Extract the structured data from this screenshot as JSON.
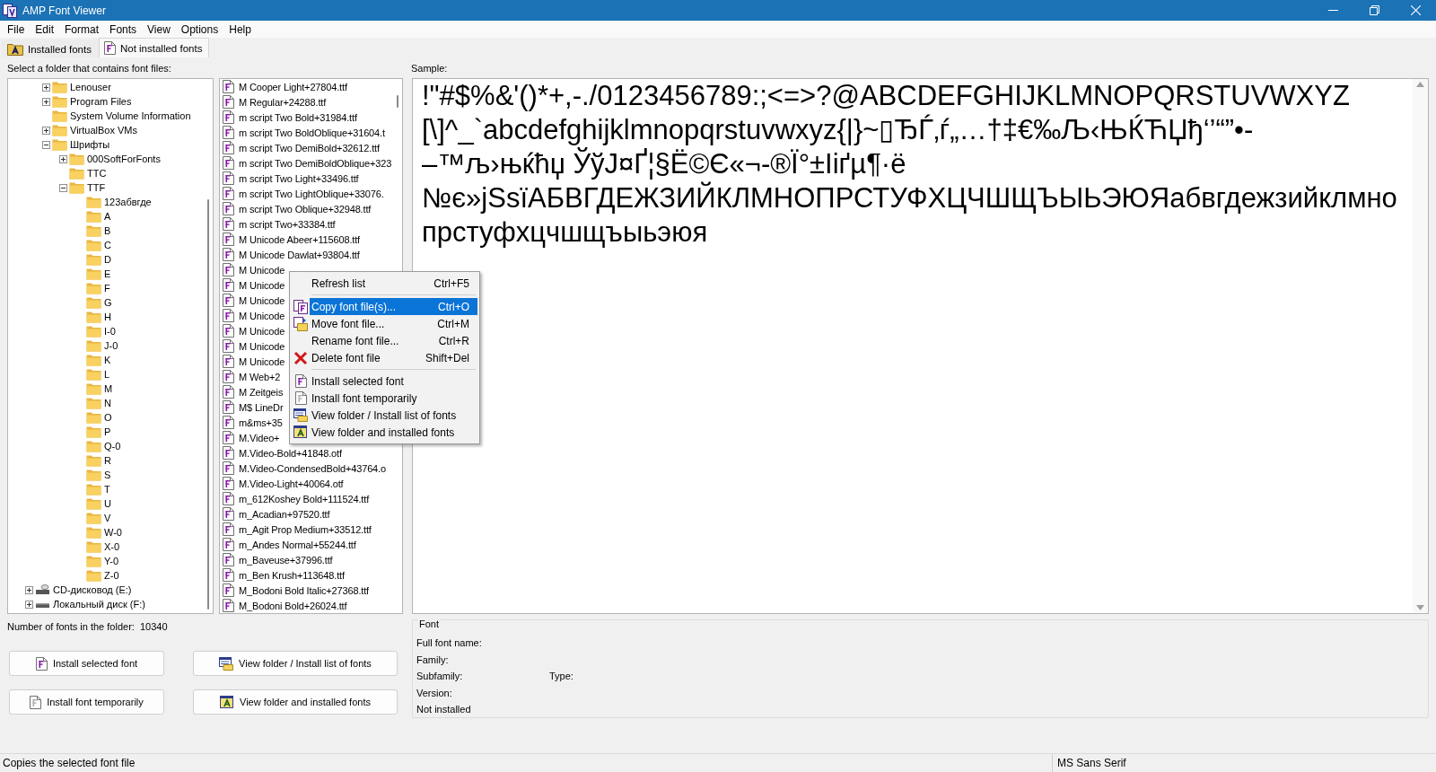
{
  "window": {
    "title": "AMP Font Viewer"
  },
  "menu_bar": [
    "File",
    "Edit",
    "Format",
    "Fonts",
    "View",
    "Options",
    "Help"
  ],
  "tabs": [
    {
      "label": "Installed fonts",
      "selected": false
    },
    {
      "label": "Not installed fonts",
      "selected": true
    }
  ],
  "folder_panel": {
    "label": "Select a folder that contains font files:",
    "tree": {
      "continued_children": [
        {
          "label": "Lenouser",
          "expanded": false
        },
        {
          "label": "Program Files",
          "expanded": false
        },
        {
          "label": "System Volume Information"
        },
        {
          "label": "VirtualBox VMs",
          "expanded": false
        },
        {
          "label": "Шрифты",
          "expanded": true,
          "children": [
            {
              "label": "000SoftForFonts",
              "expanded": false
            },
            {
              "label": "TTC"
            },
            {
              "label": "TTF",
              "expanded": true,
              "children": [
                {
                  "label": "123абвгде"
                },
                {
                  "label": "A"
                },
                {
                  "label": "B"
                },
                {
                  "label": "C"
                },
                {
                  "label": "D"
                },
                {
                  "label": "E"
                },
                {
                  "label": "F"
                },
                {
                  "label": "G"
                },
                {
                  "label": "H"
                },
                {
                  "label": "I-0"
                },
                {
                  "label": "J-0"
                },
                {
                  "label": "K"
                },
                {
                  "label": "L"
                },
                {
                  "label": "M"
                },
                {
                  "label": "N"
                },
                {
                  "label": "O"
                },
                {
                  "label": "P"
                },
                {
                  "label": "Q-0"
                },
                {
                  "label": "R"
                },
                {
                  "label": "S"
                },
                {
                  "label": "T"
                },
                {
                  "label": "U"
                },
                {
                  "label": "V"
                },
                {
                  "label": "W-0"
                },
                {
                  "label": "X-0"
                },
                {
                  "label": "Y-0"
                },
                {
                  "label": "Z-0"
                }
              ]
            }
          ]
        }
      ],
      "items": [
        {
          "label": "CD-дисковод (E:)",
          "kind": "cd_drive",
          "expanded": false
        },
        {
          "label": "Локальный диск (F:)",
          "kind": "disk_drive",
          "expanded": false
        }
      ]
    },
    "count_label": "Number of fonts in the folder:",
    "count": "10340"
  },
  "font_list": {
    "items": [
      "M Cooper Light+27804.ttf",
      "M Regular+24288.ttf",
      "m script Two Bold+31984.ttf",
      "m script Two BoldOblique+31604.t",
      "m script Two DemiBold+32612.ttf",
      "m script Two DemiBoldOblique+323",
      "m script Two Light+33496.ttf",
      "m script Two LightOblique+33076.",
      "m script Two Oblique+32948.ttf",
      "m script Two+33384.ttf",
      "M Unicode Abeer+115608.ttf",
      "M Unicode Dawlat+93804.ttf",
      "M Unicode",
      "M Unicode",
      "M Unicode",
      "M Unicode",
      "M Unicode",
      "M Unicode",
      "M Unicode",
      "M Web+2",
      "M Zeitgeis",
      "M$ LineDr",
      "m&ms+35",
      "M.Video+",
      "M.Video-Bold+41848.otf",
      "M.Video-CondensedBold+43764.o",
      "M.Video-Light+40064.otf",
      "m_612Koshey Bold+111524.ttf",
      "m_Acadian+97520.ttf",
      "m_Agit Prop Medium+33512.ttf",
      "m_Andes Normal+55244.ttf",
      "m_Baveuse+37996.ttf",
      "m_Ben Krush+113648.ttf",
      "M_Bodoni Bold Italic+27368.ttf",
      "M_Bodoni Bold+26024.ttf"
    ]
  },
  "sample": {
    "label": "Sample:",
    "lines": [
      "!\"#$%&'()*+,-./0123456789:;<=>?@ABCDEFGHIJKLMNOPQRSTUVWXYZ",
      "[\\]^_`abcdefghijklmnopqrstuvwxyz{|}~▯ЂЃ‚ѓ„…†‡€‰Љ‹ЊЌЋЏђ‘’“”•-",
      "–™љ›њќћџ ЎўЈ¤Ґ¦§Ё©Є«¬-®Ї°±Іiґµ¶·ё",
      "№є»jЅѕїАБВГДЕЖЗИЙКЛМНОПРСТУФХЦЧШЩЪЫЬЭЮЯабвгдежзийклмно",
      "прстуфхцчшщъыьэюя"
    ]
  },
  "buttons": [
    "Install selected font",
    "View folder / Install list of fonts",
    "Install font temporarily",
    "View folder and installed fonts"
  ],
  "font_info": {
    "title": "Font",
    "rows": [
      [
        "Full font name:"
      ],
      [
        "Family:"
      ],
      [
        "Subfamily:",
        "Type:"
      ],
      [
        "Version:"
      ],
      [
        "Not installed"
      ]
    ]
  },
  "context_menu": {
    "items": [
      {
        "kind": "item",
        "label": "Refresh list",
        "shortcut": "Ctrl+F5",
        "selected": false
      },
      {
        "kind": "separator"
      },
      {
        "kind": "item",
        "label": "Copy font file(s)...",
        "shortcut": "Ctrl+O",
        "selected": true
      },
      {
        "kind": "item",
        "label": "Move font file...",
        "shortcut": "Ctrl+M",
        "selected": false
      },
      {
        "kind": "item",
        "label": "Rename font file...",
        "shortcut": "Ctrl+R",
        "selected": false
      },
      {
        "kind": "item",
        "label": "Delete font file",
        "shortcut": "Shift+Del",
        "selected": false
      },
      {
        "kind": "separator"
      },
      {
        "kind": "item",
        "label": "Install selected font",
        "selected": false
      },
      {
        "kind": "item",
        "label": "Install font temporarily",
        "selected": false
      },
      {
        "kind": "item",
        "label": "View folder / Install list of fonts",
        "selected": false
      },
      {
        "kind": "item",
        "label": "View folder and installed fonts",
        "selected": false
      }
    ]
  },
  "status_bar": {
    "message": "Copies the selected font file",
    "font": "MS Sans Serif"
  }
}
